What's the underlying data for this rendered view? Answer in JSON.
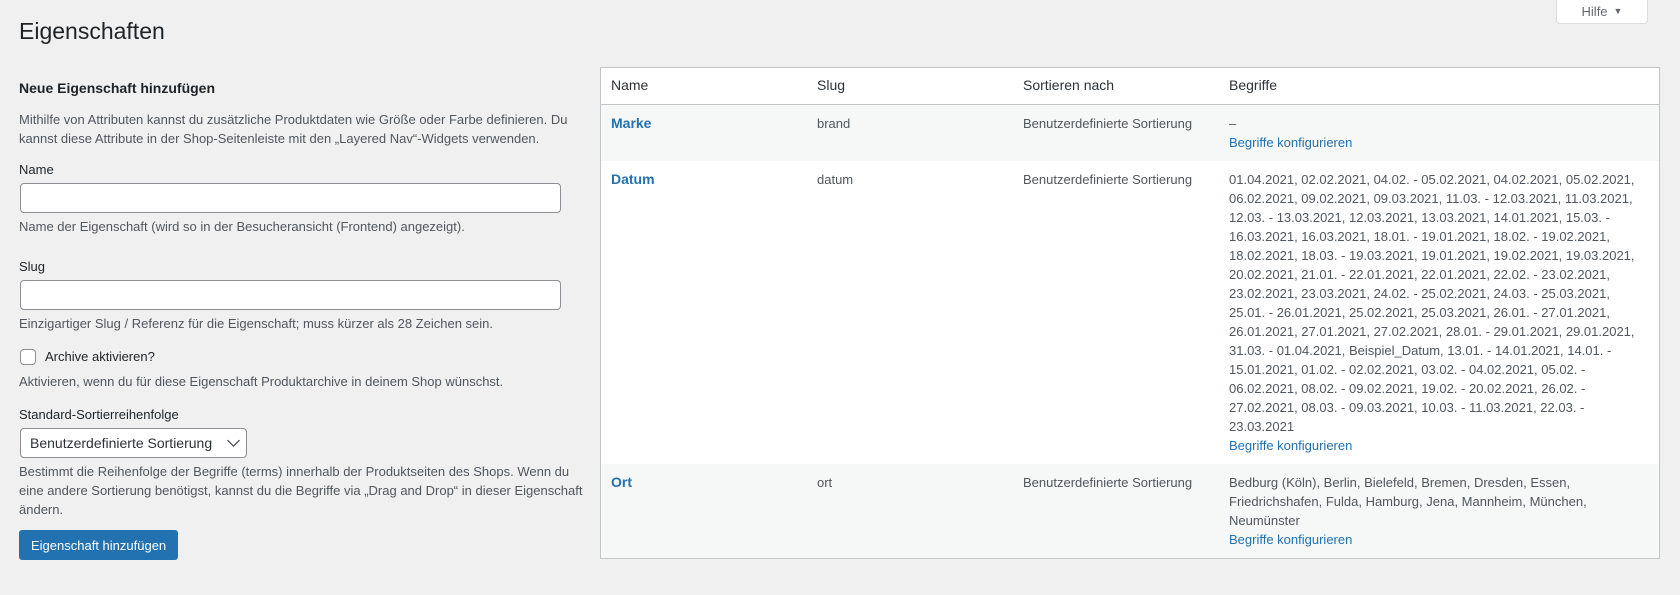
{
  "help": {
    "label": "Hilfe"
  },
  "page": {
    "title": "Eigenschaften"
  },
  "form": {
    "heading": "Neue Eigenschaft hinzufügen",
    "intro": "Mithilfe von Attributen kannst du zusätzliche Produktdaten wie Größe oder Farbe definieren. Du kannst diese Attribute in der Shop-Seitenleiste mit den „Layered Nav“-Widgets verwenden.",
    "name_label": "Name",
    "name_value": "",
    "name_hint": "Name der Eigenschaft (wird so in der Besucheransicht (Frontend) angezeigt).",
    "slug_label": "Slug",
    "slug_value": "",
    "slug_hint": "Einzigartiger Slug / Referenz für die Eigenschaft; muss kürzer als 28 Zeichen sein.",
    "archive_label": "Archive aktivieren?",
    "archive_hint": "Aktivieren, wenn du für diese Eigenschaft Produktarchive in deinem Shop wünschst.",
    "sort_label": "Standard-Sortierreihenfolge",
    "sort_value": "Benutzerdefinierte Sortierung",
    "sort_hint": "Bestimmt die Reihenfolge der Begriffe (terms) innerhalb der Produktseiten des Shops. Wenn du eine andere Sortierung benötigst, kannst du die Begriffe via „Drag and Drop“ in dieser Eigenschaft ändern.",
    "submit_label": "Eigenschaft hinzufügen"
  },
  "table": {
    "columns": [
      "Name",
      "Slug",
      "Sortieren nach",
      "Begriffe"
    ],
    "rows": [
      {
        "name": "Marke",
        "slug": "brand",
        "sort": "Benutzerdefinierte Sortierung",
        "terms": "–",
        "configure": "Begriffe konfigurieren"
      },
      {
        "name": "Datum",
        "slug": "datum",
        "sort": "Benutzerdefinierte Sortierung",
        "terms": "01.04.2021, 02.02.2021, 04.02. - 05.02.2021, 04.02.2021, 05.02.2021, 06.02.2021, 09.02.2021, 09.03.2021, 11.03. - 12.03.2021, 11.03.2021, 12.03. - 13.03.2021, 12.03.2021, 13.03.2021, 14.01.2021, 15.03. - 16.03.2021, 16.03.2021, 18.01. - 19.01.2021, 18.02. - 19.02.2021, 18.02.2021, 18.03. - 19.03.2021, 19.01.2021, 19.02.2021, 19.03.2021, 20.02.2021, 21.01. - 22.01.2021, 22.01.2021, 22.02. - 23.02.2021, 23.02.2021, 23.03.2021, 24.02. - 25.02.2021, 24.03. - 25.03.2021, 25.01. - 26.01.2021, 25.02.2021, 25.03.2021, 26.01. - 27.01.2021, 26.01.2021, 27.01.2021, 27.02.2021, 28.01. - 29.01.2021, 29.01.2021, 31.03. - 01.04.2021, Beispiel_Datum, 13.01. - 14.01.2021, 14.01. - 15.01.2021, 01.02. - 02.02.2021, 03.02. - 04.02.2021, 05.02. - 06.02.2021, 08.02. - 09.02.2021, 19.02. - 20.02.2021, 26.02. - 27.02.2021, 08.03. - 09.03.2021, 10.03. - 11.03.2021, 22.03. - 23.03.2021",
        "configure": "Begriffe konfigurieren"
      },
      {
        "name": "Ort",
        "slug": "ort",
        "sort": "Benutzerdefinierte Sortierung",
        "terms": "Bedburg (Köln), Berlin, Bielefeld, Bremen, Dresden, Essen, Friedrichshafen, Fulda, Hamburg, Jena, Mannheim, München, Neumünster",
        "configure": "Begriffe konfigurieren"
      }
    ]
  }
}
